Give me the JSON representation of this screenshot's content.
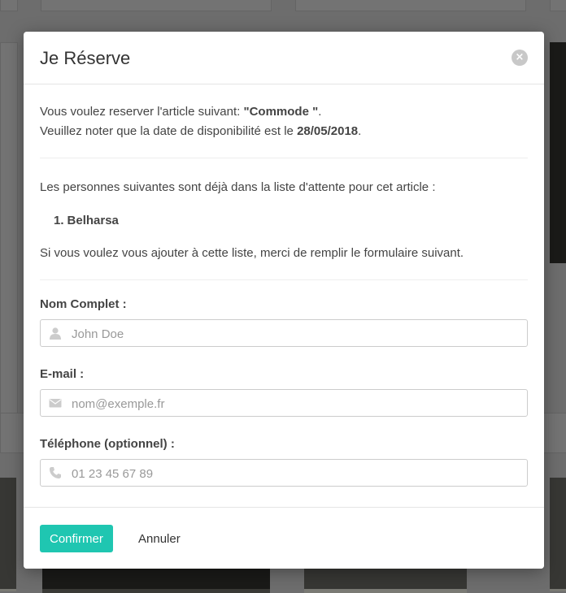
{
  "modal": {
    "title": "Je Réserve",
    "close_symbol": "×",
    "intro_prefix": "Vous voulez reserver l'article suivant: ",
    "article_name": "\"Commode \"",
    "intro_suffix": ".",
    "availability_prefix": "Veuillez noter que la date de disponibilité est le ",
    "availability_date": "28/05/2018",
    "availability_suffix": ".",
    "waitlist_intro": "Les personnes suivantes sont déjà dans la liste d'attente pour cet article :",
    "waitlist": [
      {
        "number": "1.",
        "name": "Belharsa"
      }
    ],
    "form_intro": "Si vous voulez vous ajouter à cette liste, merci de remplir le formulaire suivant.",
    "fields": {
      "name": {
        "label": "Nom Complet :",
        "placeholder": "John Doe",
        "value": "",
        "icon": "user-icon"
      },
      "email": {
        "label": "E-mail :",
        "placeholder": "nom@exemple.fr",
        "value": "",
        "icon": "envelope-icon"
      },
      "phone": {
        "label": "Téléphone (optionnel) :",
        "placeholder": "01 23 45 67 89",
        "value": "",
        "icon": "phone-icon"
      }
    },
    "confirm_label": "Confirmer",
    "cancel_label": "Annuler"
  },
  "colors": {
    "accent": "#1fc6b1",
    "icon_gray": "#cccccc",
    "overlay": "rgba(0,0,0,0.55)"
  }
}
